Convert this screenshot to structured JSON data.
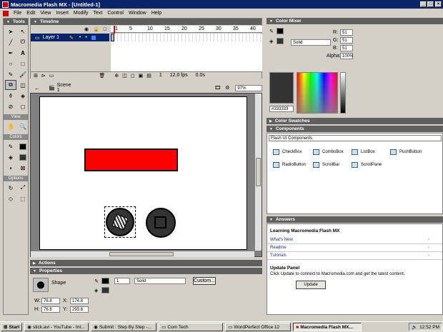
{
  "window": {
    "title": "Macromedia Flash MX - [Untitled-1]"
  },
  "menu": [
    "File",
    "Edit",
    "View",
    "Insert",
    "Modify",
    "Text",
    "Control",
    "Window",
    "Help"
  ],
  "tools": {
    "title": "Tools",
    "view_label": "View",
    "colors_label": "Colors",
    "options_label": "Options"
  },
  "timeline": {
    "title": "Timeline",
    "layer_name": "Layer 1",
    "frame_numbers": [
      "1",
      "5",
      "10",
      "15",
      "20",
      "25",
      "30",
      "35",
      "40"
    ],
    "current_frame": "1",
    "fps": "12.0 fps",
    "time": "0.0s"
  },
  "stagebar": {
    "scene": "Scene 1",
    "zoom": "97%"
  },
  "actions": {
    "title": "Actions"
  },
  "properties": {
    "title": "Properties",
    "kind": "Shape",
    "stroke_width": "1",
    "stroke_style": "Solid",
    "custom_button": "Custom...",
    "w_label": "W:",
    "w": "76.8",
    "h_label": "H:",
    "h": "76.8",
    "x_label": "X:",
    "x": "174.8",
    "y_label": "Y:",
    "y": "293.8"
  },
  "color_mixer": {
    "title": "Color Mixer",
    "fill_type": "Solid",
    "r_label": "R:",
    "r": "51",
    "g_label": "G:",
    "g": "51",
    "b_label": "B:",
    "b": "51",
    "alpha_label": "Alpha:",
    "alpha": "100%",
    "hex": "#333333"
  },
  "color_swatches": {
    "title": "Color Swatches"
  },
  "components": {
    "title": "Components",
    "set": "Flash UI Components",
    "items": [
      "CheckBox",
      "ComboBox",
      "ListBox",
      "PushButton",
      "RadioButton",
      "ScrollBar",
      "ScrollPane"
    ]
  },
  "answers": {
    "title": "Answers",
    "heading": "Learning Macromedia Flash MX",
    "links": [
      "What's New",
      "Readme",
      "Tutorials"
    ],
    "update_title": "Update Panel",
    "update_text": "Click Update to connect to Macromedia.com and get the latest content.",
    "update_button": "Update"
  },
  "taskbar": {
    "start": "Start",
    "items": [
      "stick.avi - YouTube - Int...",
      "Submit : Step By Step -...",
      "Com Tech",
      "WordPerfect Office 12",
      "Macromedia Flash MX..."
    ],
    "clock": "12:52 PM"
  },
  "colors": {
    "title_blue": "#0a246a",
    "panel_head": "#5f5f5f",
    "rect_fill": "#ff0000",
    "circle_fill": "#333333"
  }
}
